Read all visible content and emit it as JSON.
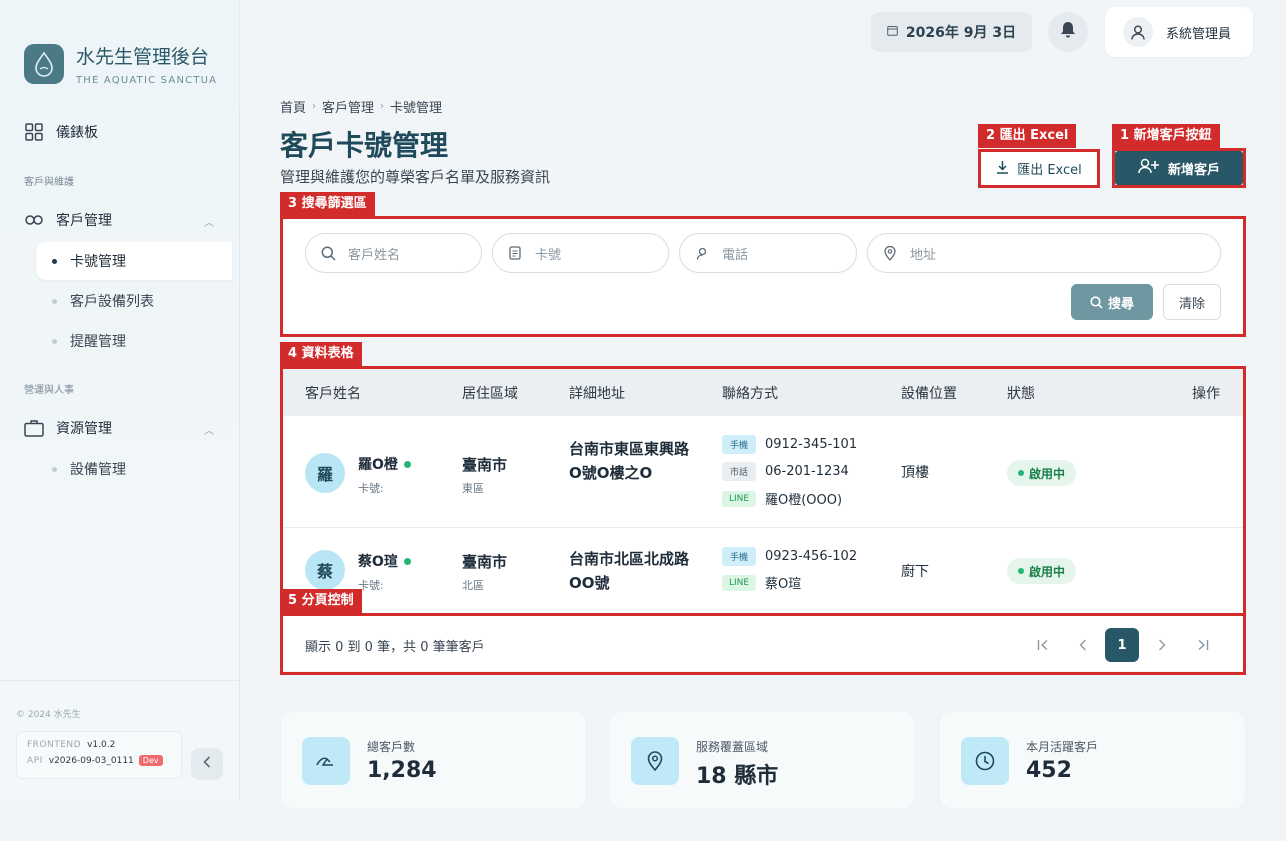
{
  "brand": {
    "title": "水先生管理後台",
    "subtitle": "THE AQUATIC SANCTUARY"
  },
  "sidebar": {
    "dashboard": "儀錶板",
    "section_customers": "客戶與維護",
    "customer_mgmt": "客戶管理",
    "sub_card": "卡號管理",
    "sub_devices": "客戶設備列表",
    "sub_reminders": "提醒管理",
    "section_ops": "營運與人事",
    "resource_mgmt": "資源管理",
    "sub_equipment": "設備管理",
    "copyright": "© 2024 水先生",
    "frontend_key": "FRONTEND",
    "frontend_val": "v1.0.2",
    "api_key": "API",
    "api_val": "v2026-09-03_0111",
    "env_badge": "Dev"
  },
  "topbar": {
    "date": "2026年 9月 3日",
    "user": "系統管理員"
  },
  "header": {
    "breadcrumb": [
      "首頁",
      "客戶管理",
      "卡號管理"
    ],
    "title": "客戶卡號管理",
    "subtitle": "管理與維護您的尊榮客戶名單及服務資訊",
    "export_label": "匯出 Excel",
    "add_label": "新增客戶"
  },
  "annotations": {
    "a1": "1 新增客戶按鈕",
    "a2": "2 匯出 Excel",
    "a3": "3 搜尋篩選區",
    "a4": "4 資料表格",
    "a5": "5 分頁控制"
  },
  "search": {
    "name_placeholder": "客戶姓名",
    "card_placeholder": "卡號",
    "phone_placeholder": "電話",
    "address_placeholder": "地址",
    "search_label": "搜尋",
    "clear_label": "清除"
  },
  "table": {
    "headers": [
      "客戶姓名",
      "居住區域",
      "詳細地址",
      "聯絡方式",
      "設備位置",
      "狀態",
      "操作"
    ],
    "rows": [
      {
        "initial": "羅",
        "name": "羅O橙",
        "card_label": "卡號:",
        "city": "臺南市",
        "district": "東區",
        "address": "台南市東區東興路O號O樓之O",
        "contacts": [
          {
            "type": "手機",
            "value": "0912-345-101"
          },
          {
            "type": "市話",
            "value": "06-201-1234"
          },
          {
            "type": "LINE",
            "value": "羅O橙(OOO)"
          }
        ],
        "location": "頂樓",
        "status": "啟用中"
      },
      {
        "initial": "蔡",
        "name": "蔡O瑄",
        "card_label": "卡號:",
        "city": "臺南市",
        "district": "北區",
        "address": "台南市北區北成路OO號",
        "contacts": [
          {
            "type": "手機",
            "value": "0923-456-102"
          },
          {
            "type": "LINE",
            "value": "蔡O瑄"
          }
        ],
        "location": "廚下",
        "status": "啟用中"
      }
    ]
  },
  "pagination": {
    "info": "顯示 0 到 0 筆，共 0 筆筆客戶",
    "current_page": "1"
  },
  "stats": [
    {
      "label": "總客戶數",
      "value": "1,284",
      "icon": "users-icon"
    },
    {
      "label": "服務覆蓋區域",
      "value": "18 縣市",
      "icon": "map-pin-icon"
    },
    {
      "label": "本月活躍客戶",
      "value": "452",
      "icon": "clock-icon"
    }
  ],
  "colors": {
    "primary": "#285868",
    "annotation": "#d22b2b",
    "success": "#22b573"
  }
}
